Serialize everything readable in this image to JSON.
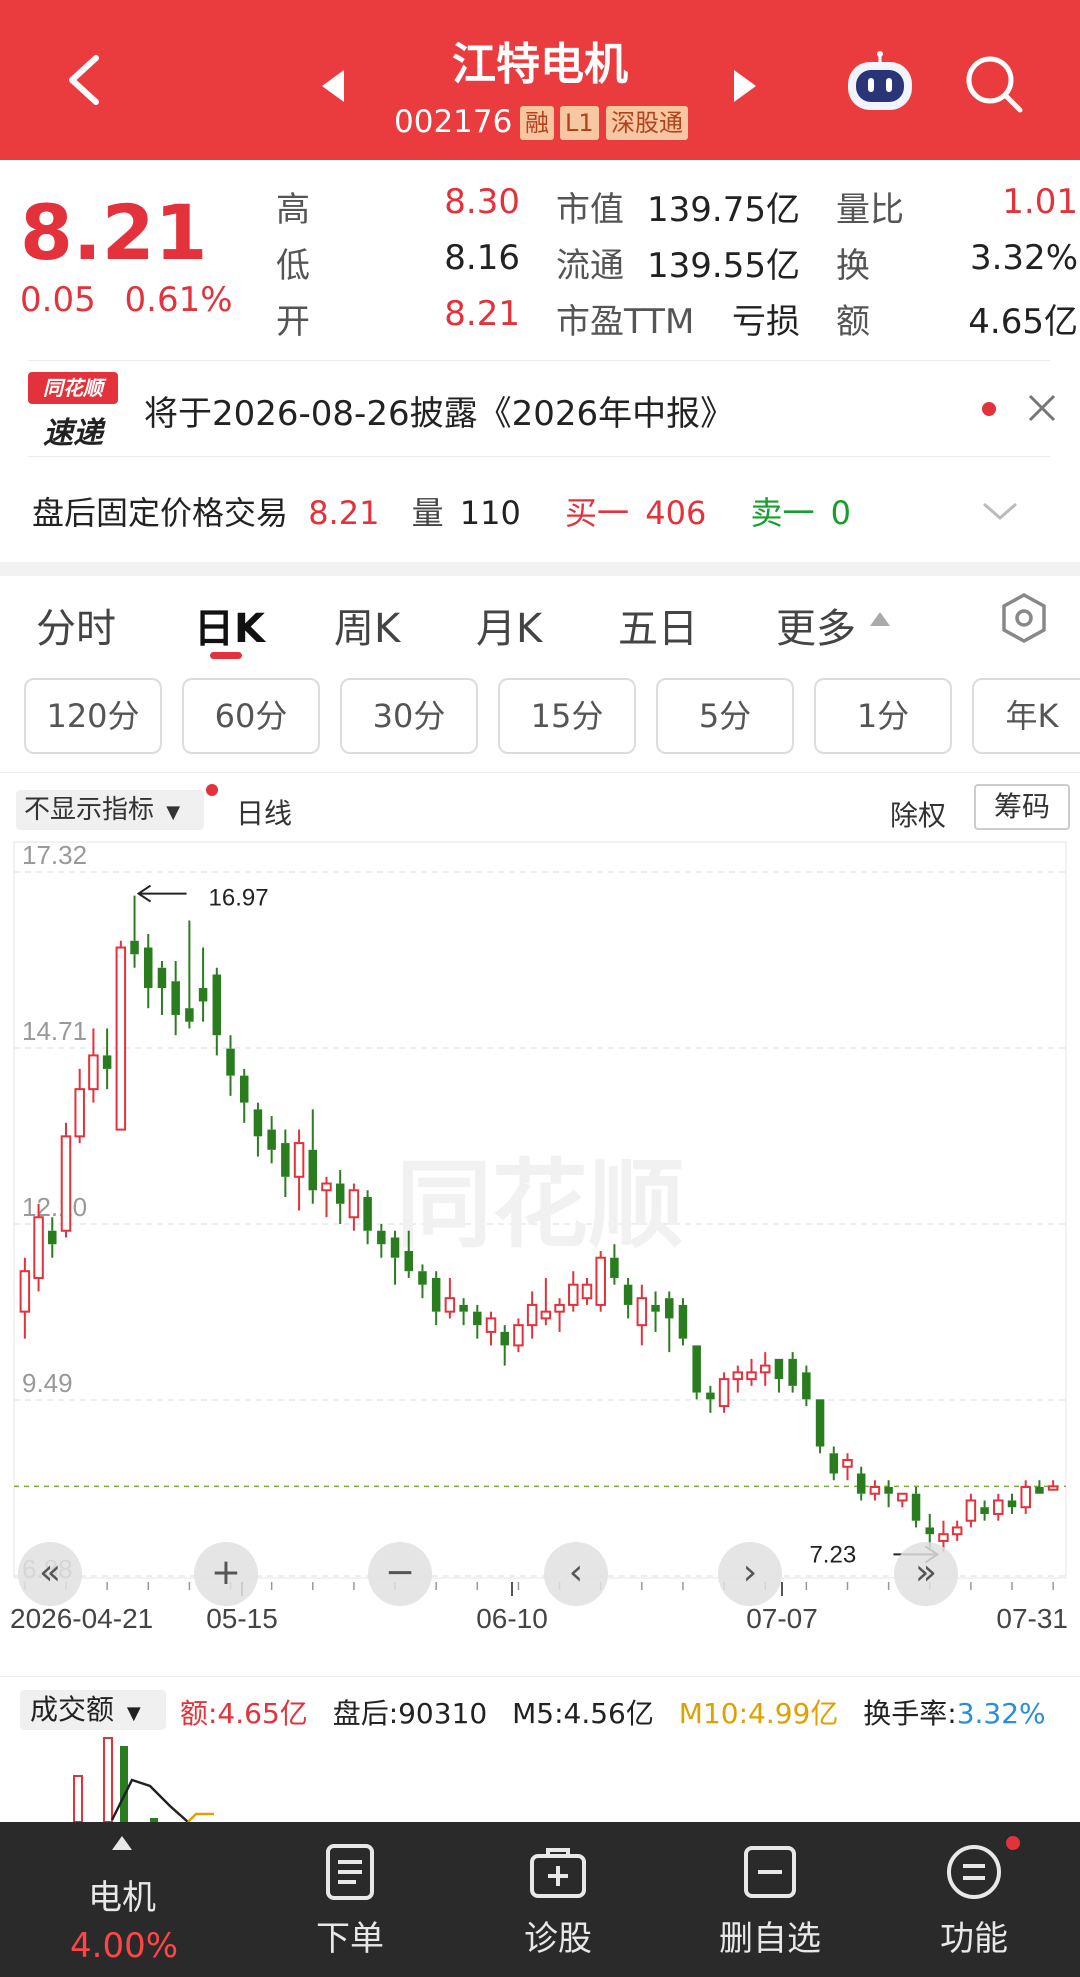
{
  "header": {
    "title": "江特电机",
    "code": "002176",
    "tags": [
      "融",
      "L1",
      "深股通"
    ]
  },
  "quote": {
    "price": "8.21",
    "change": "0.05",
    "change_pct": "0.61%",
    "rows": [
      {
        "l1": "高",
        "v1": "8.30",
        "l2": "市值",
        "v2": "139.75亿",
        "l3": "量比",
        "v3": "1.01"
      },
      {
        "l1": "低",
        "v1": "8.16",
        "l2": "流通",
        "v2": "139.55亿",
        "l3": "换",
        "v3": "3.32%"
      },
      {
        "l1": "开",
        "v1": "8.21",
        "l2": "市盈TTM",
        "v2": "亏损",
        "l3": "额",
        "v3": "4.65亿"
      }
    ]
  },
  "news": {
    "logo_top": "同花顺",
    "logo_bottom": "速递",
    "text": "将于2026-08-26披露《2026年中报》"
  },
  "afterhours": {
    "label": "盘后固定价格交易",
    "price": "8.21",
    "vol_label": "量",
    "vol": "110",
    "buy_label": "买一",
    "buy": "406",
    "sell_label": "卖一",
    "sell": "0"
  },
  "tabs": [
    "分时",
    "日K",
    "周K",
    "月K",
    "五日",
    "更多"
  ],
  "active_tab": "日K",
  "subtabs": [
    "120分",
    "60分",
    "30分",
    "15分",
    "5分",
    "1分",
    "年K"
  ],
  "chart_bar": {
    "indicator": "不显示指标",
    "line_type": "日线",
    "right1": "除权",
    "right2": "筹码"
  },
  "watermark": "同花顺",
  "volume_bar": {
    "label": "成交额",
    "amount": "额:4.65亿",
    "after": "盘后:90310",
    "m5": "M5:4.56亿",
    "m10": "M10:4.99亿",
    "turnover_label": "换手率:",
    "turnover": "3.32%"
  },
  "chart_data": {
    "type": "candlestick",
    "y_ticks": [
      "17.32",
      "14.71",
      "12.10",
      "9.49",
      "6.88"
    ],
    "ylim": [
      6.88,
      17.32
    ],
    "x_ticks": [
      "2026-04-21",
      "05-15",
      "06-10",
      "07-07",
      "07-31"
    ],
    "max_label": "16.97",
    "min_label": "7.23",
    "last_price": 8.21,
    "candles": [
      {
        "o": 10.8,
        "c": 11.4,
        "h": 11.6,
        "l": 10.4
      },
      {
        "o": 11.3,
        "c": 12.2,
        "h": 12.4,
        "l": 11.1
      },
      {
        "o": 12.0,
        "c": 11.8,
        "h": 12.2,
        "l": 11.6
      },
      {
        "o": 12.0,
        "c": 13.4,
        "h": 13.6,
        "l": 11.9
      },
      {
        "o": 13.4,
        "c": 14.1,
        "h": 14.4,
        "l": 13.3
      },
      {
        "o": 14.1,
        "c": 14.6,
        "h": 15.0,
        "l": 13.9
      },
      {
        "o": 14.6,
        "c": 14.4,
        "h": 15.0,
        "l": 14.1
      },
      {
        "o": 13.5,
        "c": 16.2,
        "h": 16.3,
        "l": 13.5
      },
      {
        "o": 16.3,
        "c": 16.1,
        "h": 16.97,
        "l": 15.9
      },
      {
        "o": 16.2,
        "c": 15.6,
        "h": 16.4,
        "l": 15.3
      },
      {
        "o": 15.9,
        "c": 15.6,
        "h": 16.0,
        "l": 15.2
      },
      {
        "o": 15.7,
        "c": 15.2,
        "h": 16.0,
        "l": 14.9
      },
      {
        "o": 15.3,
        "c": 15.1,
        "h": 16.6,
        "l": 15.0
      },
      {
        "o": 15.6,
        "c": 15.4,
        "h": 16.2,
        "l": 15.1
      },
      {
        "o": 15.8,
        "c": 14.9,
        "h": 15.9,
        "l": 14.6
      },
      {
        "o": 14.7,
        "c": 14.3,
        "h": 14.9,
        "l": 14.0
      },
      {
        "o": 14.3,
        "c": 13.9,
        "h": 14.4,
        "l": 13.6
      },
      {
        "o": 13.8,
        "c": 13.4,
        "h": 13.9,
        "l": 13.1
      },
      {
        "o": 13.5,
        "c": 13.2,
        "h": 13.7,
        "l": 13.0
      },
      {
        "o": 13.3,
        "c": 12.8,
        "h": 13.5,
        "l": 12.5
      },
      {
        "o": 12.8,
        "c": 13.3,
        "h": 13.5,
        "l": 12.3
      },
      {
        "o": 13.2,
        "c": 12.6,
        "h": 13.8,
        "l": 12.4
      },
      {
        "o": 12.6,
        "c": 12.7,
        "h": 12.8,
        "l": 12.2
      },
      {
        "o": 12.7,
        "c": 12.4,
        "h": 12.9,
        "l": 12.1
      },
      {
        "o": 12.2,
        "c": 12.6,
        "h": 12.7,
        "l": 12.0
      },
      {
        "o": 12.5,
        "c": 12.0,
        "h": 12.6,
        "l": 11.8
      },
      {
        "o": 12.0,
        "c": 11.8,
        "h": 12.1,
        "l": 11.6
      },
      {
        "o": 11.9,
        "c": 11.6,
        "h": 12.0,
        "l": 11.2
      },
      {
        "o": 11.7,
        "c": 11.4,
        "h": 12.0,
        "l": 11.3
      },
      {
        "o": 11.4,
        "c": 11.2,
        "h": 11.5,
        "l": 11.0
      },
      {
        "o": 11.3,
        "c": 10.8,
        "h": 11.4,
        "l": 10.6
      },
      {
        "o": 10.8,
        "c": 11.0,
        "h": 11.3,
        "l": 10.7
      },
      {
        "o": 10.9,
        "c": 10.8,
        "h": 11.0,
        "l": 10.6
      },
      {
        "o": 10.8,
        "c": 10.6,
        "h": 10.9,
        "l": 10.4
      },
      {
        "o": 10.5,
        "c": 10.7,
        "h": 10.8,
        "l": 10.3
      },
      {
        "o": 10.5,
        "c": 10.3,
        "h": 10.6,
        "l": 10.0
      },
      {
        "o": 10.3,
        "c": 10.6,
        "h": 10.7,
        "l": 10.2
      },
      {
        "o": 10.6,
        "c": 10.9,
        "h": 11.1,
        "l": 10.4
      },
      {
        "o": 10.7,
        "c": 10.8,
        "h": 11.3,
        "l": 10.6
      },
      {
        "o": 10.8,
        "c": 10.9,
        "h": 11.0,
        "l": 10.5
      },
      {
        "o": 10.9,
        "c": 11.2,
        "h": 11.4,
        "l": 10.8
      },
      {
        "o": 11.0,
        "c": 11.2,
        "h": 11.3,
        "l": 10.9
      },
      {
        "o": 10.9,
        "c": 11.6,
        "h": 11.7,
        "l": 10.8
      },
      {
        "o": 11.6,
        "c": 11.3,
        "h": 11.8,
        "l": 11.2
      },
      {
        "o": 11.2,
        "c": 10.9,
        "h": 11.3,
        "l": 10.7
      },
      {
        "o": 10.6,
        "c": 11.0,
        "h": 11.2,
        "l": 10.3
      },
      {
        "o": 10.9,
        "c": 10.8,
        "h": 11.1,
        "l": 10.5
      },
      {
        "o": 11.0,
        "c": 10.7,
        "h": 11.1,
        "l": 10.2
      },
      {
        "o": 10.9,
        "c": 10.4,
        "h": 11.0,
        "l": 10.3
      },
      {
        "o": 10.3,
        "c": 9.6,
        "h": 10.3,
        "l": 9.5
      },
      {
        "o": 9.6,
        "c": 9.5,
        "h": 9.7,
        "l": 9.3
      },
      {
        "o": 9.4,
        "c": 9.8,
        "h": 9.9,
        "l": 9.3
      },
      {
        "o": 9.8,
        "c": 9.9,
        "h": 10.0,
        "l": 9.6
      },
      {
        "o": 9.8,
        "c": 9.9,
        "h": 10.1,
        "l": 9.7
      },
      {
        "o": 9.9,
        "c": 10.0,
        "h": 10.2,
        "l": 9.7
      },
      {
        "o": 10.1,
        "c": 9.8,
        "h": 10.1,
        "l": 9.6
      },
      {
        "o": 10.1,
        "c": 9.7,
        "h": 10.2,
        "l": 9.6
      },
      {
        "o": 9.9,
        "c": 9.5,
        "h": 10.0,
        "l": 9.4
      },
      {
        "o": 9.5,
        "c": 8.8,
        "h": 9.5,
        "l": 8.7
      },
      {
        "o": 8.7,
        "c": 8.4,
        "h": 8.8,
        "l": 8.3
      },
      {
        "o": 8.5,
        "c": 8.6,
        "h": 8.7,
        "l": 8.3
      },
      {
        "o": 8.4,
        "c": 8.1,
        "h": 8.5,
        "l": 8.0
      },
      {
        "o": 8.1,
        "c": 8.2,
        "h": 8.3,
        "l": 8.0
      },
      {
        "o": 8.2,
        "c": 8.1,
        "h": 8.3,
        "l": 7.9
      },
      {
        "o": 8.0,
        "c": 8.1,
        "h": 8.1,
        "l": 7.9
      },
      {
        "o": 8.1,
        "c": 7.7,
        "h": 8.2,
        "l": 7.6
      },
      {
        "o": 7.6,
        "c": 7.5,
        "h": 7.8,
        "l": 7.3
      },
      {
        "o": 7.4,
        "c": 7.5,
        "h": 7.7,
        "l": 7.23
      },
      {
        "o": 7.5,
        "c": 7.6,
        "h": 7.7,
        "l": 7.4
      },
      {
        "o": 7.7,
        "c": 8.0,
        "h": 8.1,
        "l": 7.6
      },
      {
        "o": 7.9,
        "c": 7.8,
        "h": 8.0,
        "l": 7.7
      },
      {
        "o": 7.8,
        "c": 8.0,
        "h": 8.1,
        "l": 7.7
      },
      {
        "o": 8.0,
        "c": 7.9,
        "h": 8.1,
        "l": 7.8
      },
      {
        "o": 7.9,
        "c": 8.2,
        "h": 8.3,
        "l": 7.8
      },
      {
        "o": 8.2,
        "c": 8.1,
        "h": 8.3,
        "l": 8.1
      },
      {
        "o": 8.16,
        "c": 8.21,
        "h": 8.3,
        "l": 8.16
      }
    ]
  },
  "bottom_nav": [
    {
      "label": "下单"
    },
    {
      "label": "诊股"
    },
    {
      "label": "删自选"
    },
    {
      "label": "功能"
    }
  ],
  "bottom_left": {
    "label": "电机",
    "pct": "4.00%"
  },
  "colors": {
    "header": "#ea3b3f",
    "up": "#e3323b",
    "down": "#2a7d1f",
    "bottom": "#2a2a2a"
  }
}
